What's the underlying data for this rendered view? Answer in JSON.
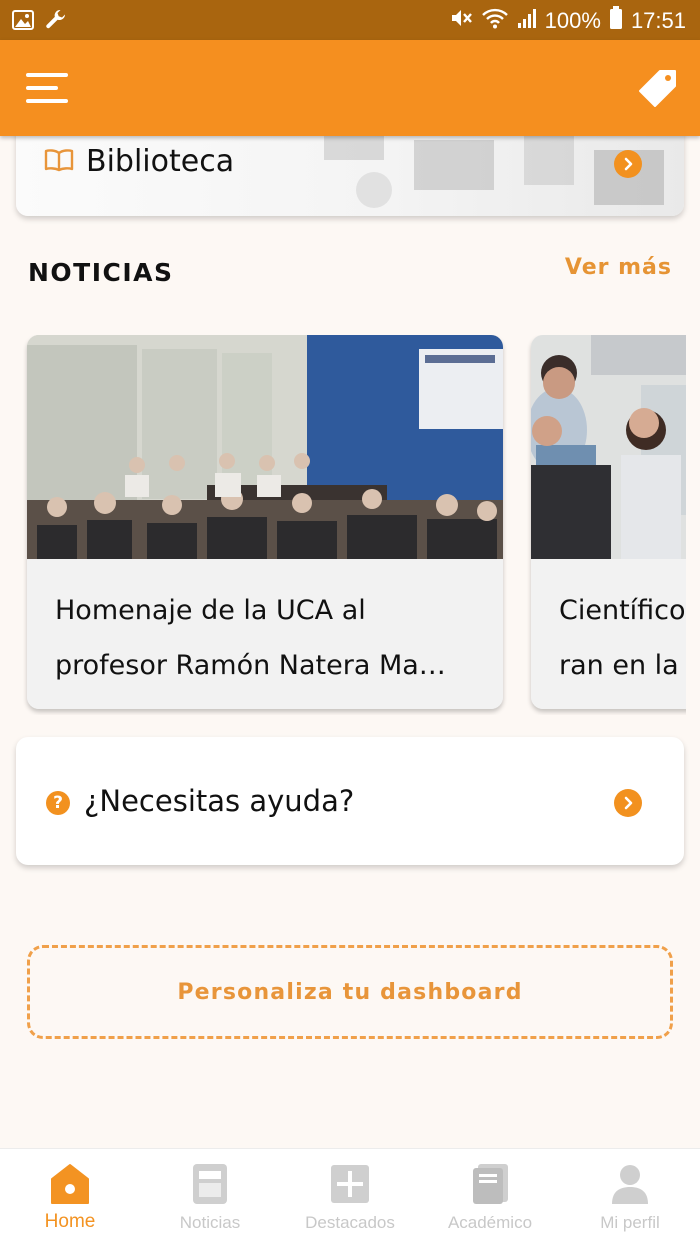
{
  "status_bar": {
    "battery": "100%",
    "time": "17:51",
    "icons": [
      "image-icon",
      "wrench-icon",
      "mute-icon",
      "wifi-icon",
      "signal-icon",
      "battery-icon"
    ]
  },
  "app_bar": {
    "menu_icon": "menu-icon",
    "tag_icon": "tag-icon"
  },
  "biblioteca": {
    "label": "Biblioteca",
    "icon": "book-icon"
  },
  "news_section": {
    "title": "NOTICIAS",
    "see_more": "Ver más",
    "items": [
      {
        "title_line1": "Homenaje de la UCA al",
        "title_line2": "profesor Ramón Natera Ma…"
      },
      {
        "title_line1": "Científico",
        "title_line2": "ran en la"
      }
    ]
  },
  "help": {
    "label": "¿Necesitas ayuda?",
    "icon": "question-icon"
  },
  "customize": {
    "label": "Personaliza tu dashboard"
  },
  "bottom_nav": {
    "items": [
      {
        "label": "Home",
        "icon": "home-icon",
        "active": true
      },
      {
        "label": "Noticias",
        "icon": "news-icon",
        "active": false
      },
      {
        "label": "Destacados",
        "icon": "plus-icon",
        "active": false
      },
      {
        "label": "Académico",
        "icon": "book-icon",
        "active": false
      },
      {
        "label": "Mi perfil",
        "icon": "user-icon",
        "active": false
      }
    ]
  },
  "colors": {
    "status_bar": "#a9650f",
    "primary": "#f58f1f",
    "accent_text": "#e69434",
    "inactive": "#c8c8c8",
    "background": "#fdf8f4"
  }
}
